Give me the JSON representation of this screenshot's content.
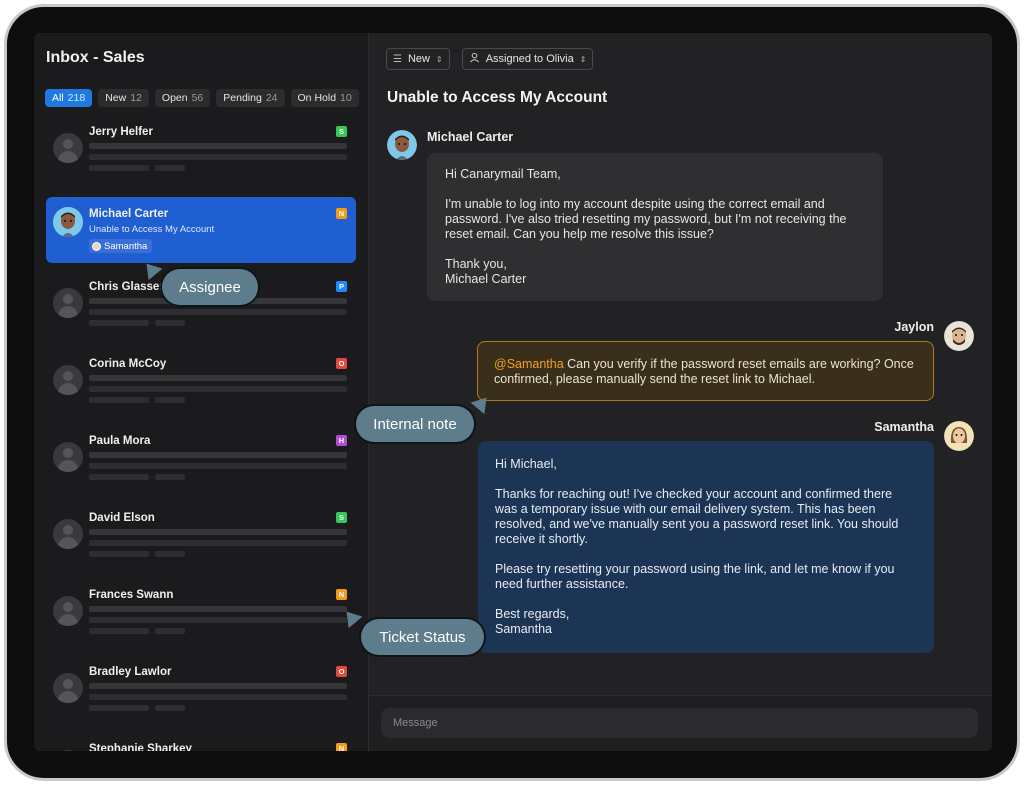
{
  "sidebar": {
    "title": "Inbox - Sales",
    "filters": [
      {
        "label": "All",
        "count": "218",
        "active": true
      },
      {
        "label": "New",
        "count": "12"
      },
      {
        "label": "Open",
        "count": "56"
      },
      {
        "label": "Pending",
        "count": "24"
      },
      {
        "label": "On Hold",
        "count": "10"
      }
    ],
    "conversations": [
      {
        "name": "Jerry Helfer",
        "status": "S",
        "status_color": "#34c759"
      },
      {
        "name": "Michael Carter",
        "status": "N",
        "status_color": "#f59a1b",
        "subject": "Unable to Access My Account",
        "assignee": "Samantha",
        "selected": true
      },
      {
        "name": "Chris Glasser",
        "status": "P",
        "status_color": "#1a8cff"
      },
      {
        "name": "Corina McCoy",
        "status": "O",
        "status_color": "#e5483f"
      },
      {
        "name": "Paula Mora",
        "status": "H",
        "status_color": "#b04fd6"
      },
      {
        "name": "David Elson",
        "status": "S",
        "status_color": "#34c759"
      },
      {
        "name": "Frances Swann",
        "status": "N",
        "status_color": "#f59a1b"
      },
      {
        "name": "Bradley Lawlor",
        "status": "O",
        "status_color": "#e5483f"
      },
      {
        "name": "Stephanie Sharkey",
        "status": "N",
        "status_color": "#f59a1b"
      }
    ]
  },
  "toolbar": {
    "status_dropdown": "New",
    "assignee_dropdown": "Assigned to Olivia"
  },
  "conversation": {
    "subject": "Unable to Access My Account",
    "messages": [
      {
        "sender": "Michael Carter",
        "paragraphs": [
          "Hi Canarymail Team,",
          "I'm unable to log into my account despite using the correct email and password. I've also tried resetting my password, but I'm not receiving the reset email. Can you help me resolve this issue?",
          "Thank you,\nMichael Carter"
        ]
      },
      {
        "sender": "Jaylon",
        "mention": "@Samantha",
        "text": " Can you verify if the password reset emails are working? Once confirmed, please manually send the reset link to Michael."
      },
      {
        "sender": "Samantha",
        "paragraphs": [
          "Hi Michael,",
          "Thanks for reaching out! I've checked your account and confirmed there was a temporary issue with our email delivery system. This has been resolved, and we've manually sent you a password reset link. You should receive it shortly.",
          "Please try resetting your password using the link, and let me know if you need further assistance.",
          "Best regards,\nSamantha"
        ]
      }
    ]
  },
  "composer": {
    "placeholder": "Message"
  },
  "callouts": {
    "assignee": "Assignee",
    "internal_note": "Internal note",
    "ticket_status": "Ticket Status"
  }
}
